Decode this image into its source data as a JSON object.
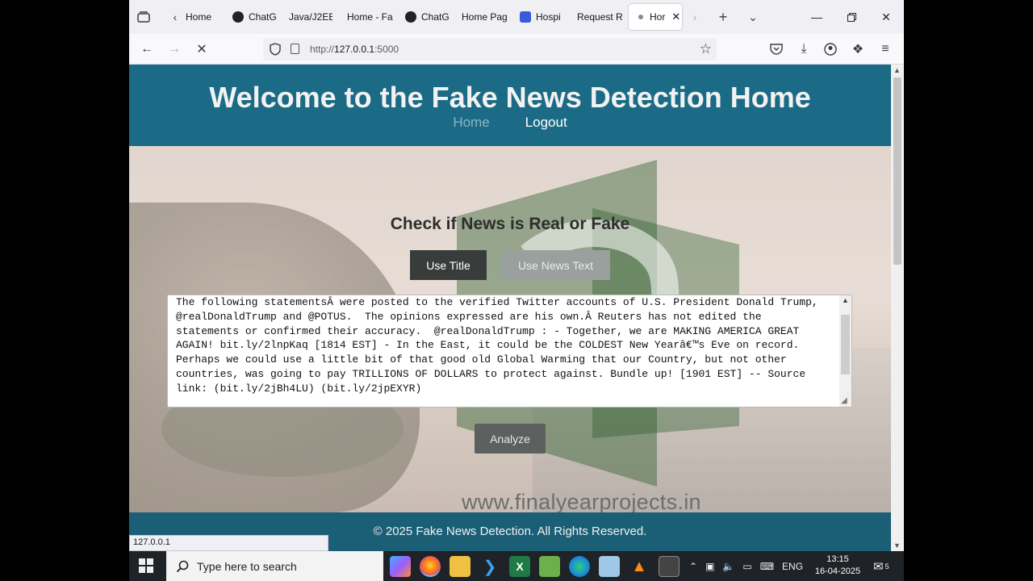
{
  "browser": {
    "tabs": [
      {
        "label": "Home"
      },
      {
        "label": "ChatG"
      },
      {
        "label": "Java/J2EE"
      },
      {
        "label": "Home - Fa"
      },
      {
        "label": "ChatG"
      },
      {
        "label": "Home Pag"
      },
      {
        "label": "Hospi"
      },
      {
        "label": "Request R"
      },
      {
        "label": "Hor",
        "active": true
      }
    ],
    "url_prefix": "http://",
    "url_host": "127.0.0.1",
    "url_port": ":5000"
  },
  "site": {
    "title": "Welcome to the Fake News Detection Home",
    "nav": {
      "home": "Home",
      "logout": "Logout"
    },
    "check_title": "Check if News is Real or Fake",
    "btn_use_title": "Use Title",
    "btn_use_text": "Use News Text",
    "news_text": "The following statementsÂ were posted to the verified Twitter accounts of U.S. President Donald Trump, @realDonaldTrump and @POTUS.  The opinions expressed are his own.Â Reuters has not edited the statements or confirmed their accuracy.  @realDonaldTrump : - Together, we are MAKING AMERICA GREAT AGAIN! bit.ly/2lnpKaq [1814 EST] - In the East, it could be the COLDEST New Yearâ€™s Eve on record. Perhaps we could use a little bit of that good old Global Warming that our Country, but not other countries, was going to pay TRILLIONS OF DOLLARS to protect against. Bundle up! [1901 EST] -- Source link: (bit.ly/2jBh4LU) (bit.ly/2jpEXYR)",
    "analyze": "Analyze",
    "footer": "© 2025 Fake News Detection. All Rights Reserved.",
    "watermark_text": "www.finalyearprojects.in"
  },
  "status_tip": "127.0.0.1",
  "taskbar": {
    "search_placeholder": "Type here to search",
    "lang": "ENG",
    "time": "13:15",
    "date": "16-04-2025",
    "notifications": "5"
  }
}
